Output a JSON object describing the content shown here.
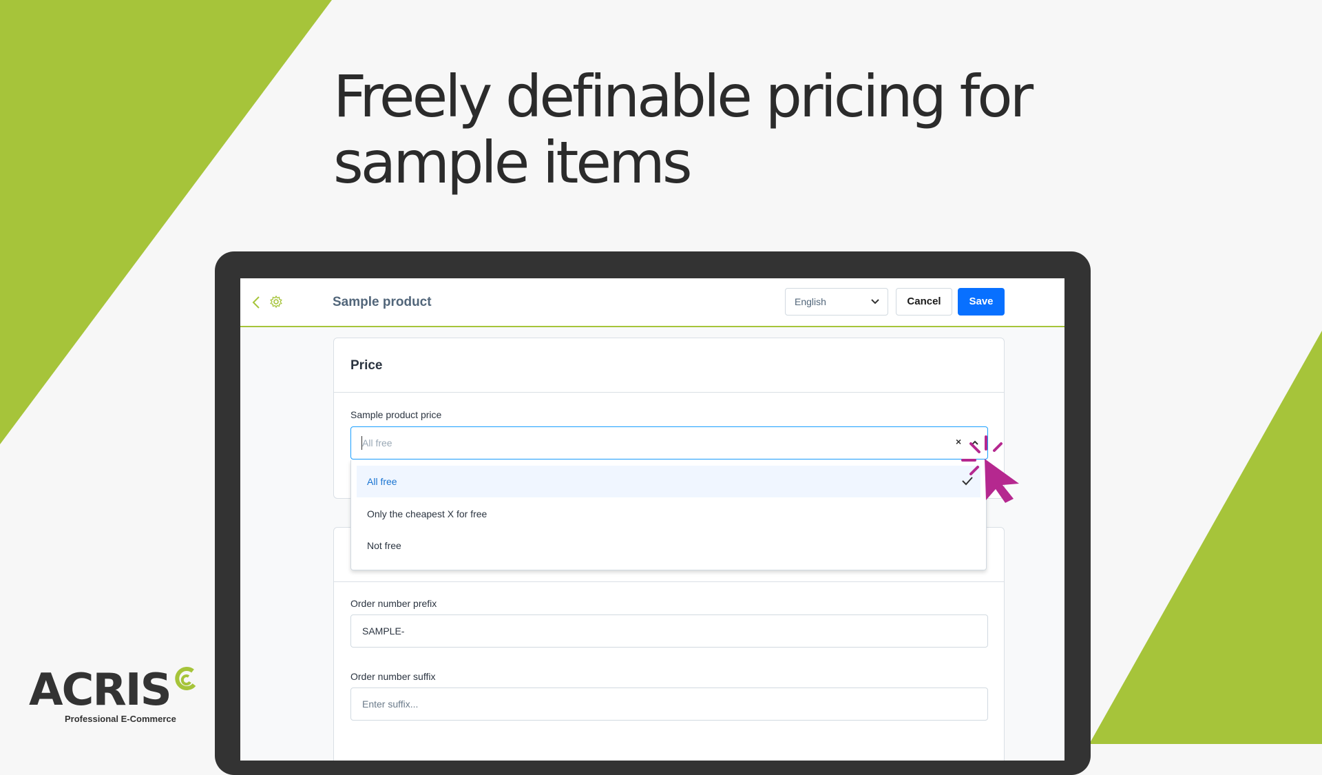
{
  "headline": {
    "line1": "Freely definable pricing for",
    "line2": "sample items"
  },
  "topbar": {
    "back_icon": "chevron-left-icon",
    "settings_icon": "gear-icon",
    "title": "Sample product",
    "language": "English",
    "cancel_label": "Cancel",
    "save_label": "Save"
  },
  "price_card": {
    "title": "Price",
    "field_label": "Sample product price",
    "placeholder": "All free",
    "clear_symbol": "×",
    "options": [
      {
        "label": "All free",
        "selected": true
      },
      {
        "label": "Only the cheapest X for free",
        "selected": false
      },
      {
        "label": "Not free",
        "selected": false
      }
    ]
  },
  "order_card": {
    "prefix_label": "Order number prefix",
    "prefix_value": "SAMPLE-",
    "suffix_label": "Order number suffix",
    "suffix_placeholder": "Enter suffix..."
  },
  "logo": {
    "name": "ACRIS",
    "tagline": "Professional E-Commerce"
  },
  "colors": {
    "brand_green": "#a6c43a",
    "primary_blue": "#0870ff",
    "cursor_magenta": "#b5288f",
    "headline_text": "#2b2b2b"
  }
}
